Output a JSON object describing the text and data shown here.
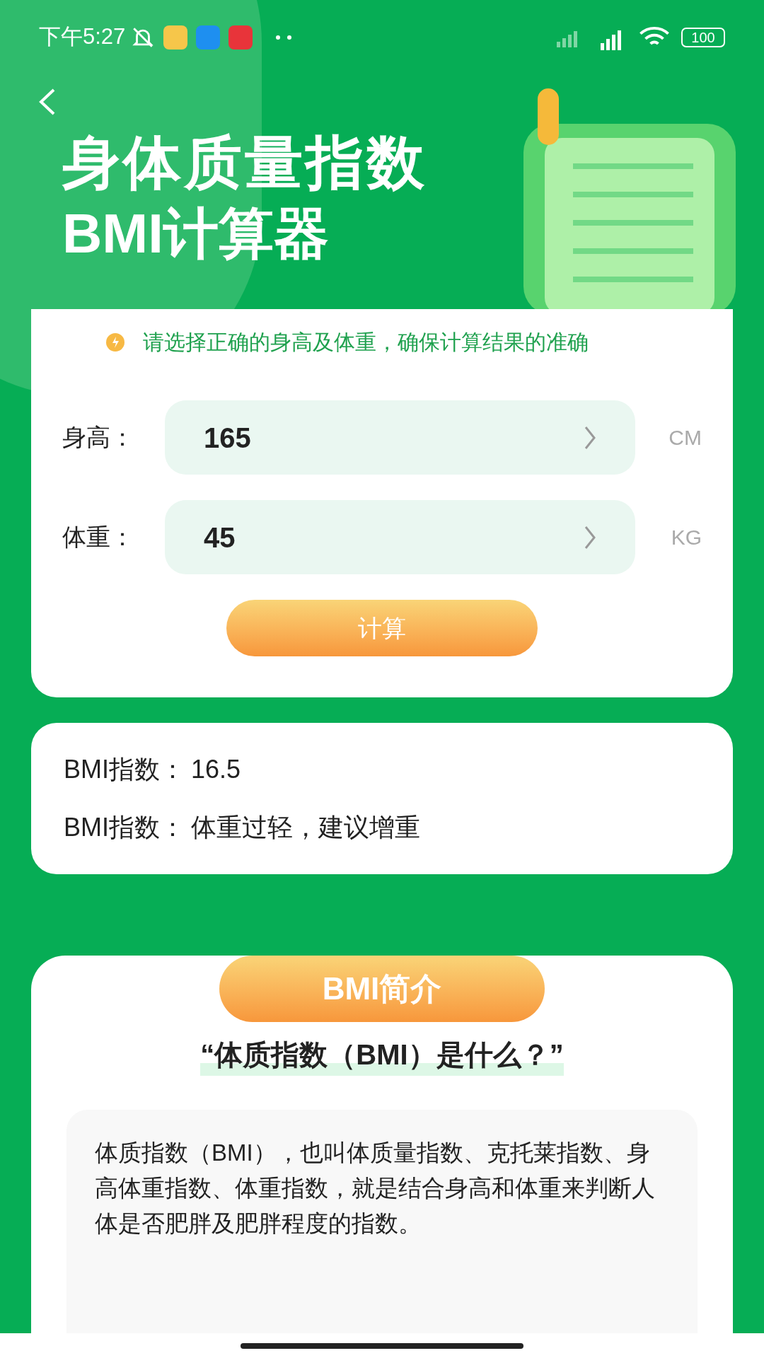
{
  "status_bar": {
    "time": "下午5:27",
    "battery": "100"
  },
  "header": {
    "title_line_1": "身体质量指数",
    "title_line_2": "BMI计算器"
  },
  "hint": "请选择正确的身高及体重，确保计算结果的准确",
  "fields": [
    {
      "label": "身高：",
      "value": "165",
      "unit": "CM"
    },
    {
      "label": "体重：",
      "value": "45",
      "unit": "KG"
    }
  ],
  "calculate_button": "计算",
  "result": {
    "lines": [
      {
        "label": "BMI指数：",
        "value": "16.5"
      },
      {
        "label": "BMI指数：",
        "value": "体重过轻，建议增重"
      }
    ]
  },
  "intro": {
    "badge": "BMI简介",
    "question": "“体质指数（BMI）是什么？”",
    "paragraph": "体质指数（BMI），也叫体质量指数、克托莱指数、身高体重指数、体重指数，就是结合身高和体重来判断人体是否肥胖及肥胖程度的指数。"
  }
}
